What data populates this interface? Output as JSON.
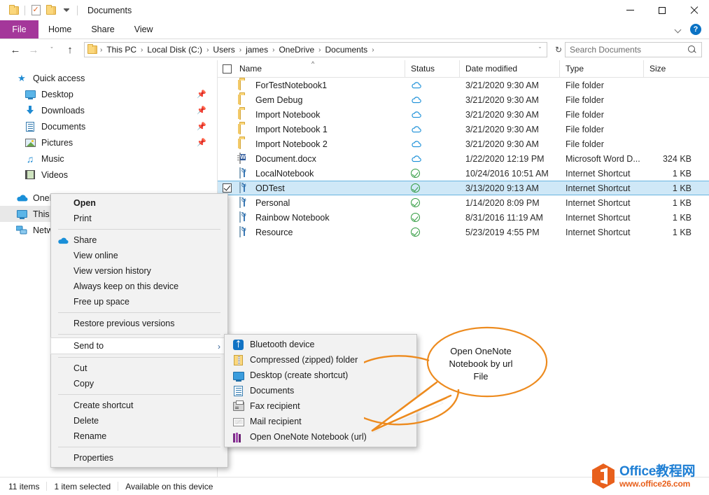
{
  "window": {
    "title": "Documents",
    "quick_access_icons": [
      "folder-icon",
      "properties-icon",
      "new-folder-icon",
      "customize-qat-caret"
    ],
    "controls": {
      "minimize": "—",
      "maximize": "□",
      "close": "✕"
    }
  },
  "ribbon": {
    "tabs": [
      {
        "label": "File",
        "active_color": "#a4379a"
      },
      {
        "label": "Home"
      },
      {
        "label": "Share"
      },
      {
        "label": "View"
      }
    ],
    "collapse_icon": "chevron-down-icon",
    "help_label": "?"
  },
  "address_bar": {
    "back_glyph": "←",
    "forward_glyph": "→",
    "recent_glyph": "ˇ",
    "up_glyph": "↑",
    "breadcrumbs": [
      "This PC",
      "Local Disk (C:)",
      "Users",
      "james",
      "OneDrive",
      "Documents"
    ],
    "separator": "›",
    "dropdown_glyph": "ˇ",
    "refresh_glyph": "↻"
  },
  "search": {
    "placeholder": "Search Documents",
    "value": "",
    "icon": "search-icon"
  },
  "sidebar": {
    "items": [
      {
        "label": "Quick access",
        "icon": "star-pin-icon",
        "level": 0,
        "pinned": false
      },
      {
        "label": "Desktop",
        "icon": "desktop-icon",
        "level": 1,
        "pinned": true
      },
      {
        "label": "Downloads",
        "icon": "downloads-icon",
        "level": 1,
        "pinned": true
      },
      {
        "label": "Documents",
        "icon": "documents-icon",
        "level": 1,
        "pinned": true
      },
      {
        "label": "Pictures",
        "icon": "pictures-icon",
        "level": 1,
        "pinned": true
      },
      {
        "label": "Music",
        "icon": "music-icon",
        "level": 1,
        "pinned": false
      },
      {
        "label": "Videos",
        "icon": "videos-icon",
        "level": 1,
        "pinned": false
      },
      {
        "label": "OneDrive",
        "icon": "onedrive-cloud-icon",
        "level": 0,
        "pinned": false
      },
      {
        "label": "This PC",
        "icon": "this-pc-icon",
        "level": 0,
        "pinned": false,
        "selected": true
      },
      {
        "label": "Network",
        "icon": "network-icon",
        "level": 0,
        "pinned": false
      }
    ]
  },
  "file_list": {
    "columns": [
      "Name",
      "Status",
      "Date modified",
      "Type",
      "Size"
    ],
    "sort_column": "Name",
    "sort_direction": "ascending",
    "rows": [
      {
        "name": "ForTestNotebook1",
        "icon": "folder-icon",
        "status": "cloud-only-icon",
        "date": "3/21/2020 9:30 AM",
        "type": "File folder",
        "size": ""
      },
      {
        "name": "Gem Debug",
        "icon": "folder-icon",
        "status": "cloud-only-icon",
        "date": "3/21/2020 9:30 AM",
        "type": "File folder",
        "size": ""
      },
      {
        "name": "Import Notebook",
        "icon": "folder-icon",
        "status": "cloud-only-icon",
        "date": "3/21/2020 9:30 AM",
        "type": "File folder",
        "size": ""
      },
      {
        "name": "Import Notebook 1",
        "icon": "folder-icon",
        "status": "cloud-only-icon",
        "date": "3/21/2020 9:30 AM",
        "type": "File folder",
        "size": ""
      },
      {
        "name": "Import Notebook 2",
        "icon": "folder-icon",
        "status": "cloud-only-icon",
        "date": "3/21/2020 9:30 AM",
        "type": "File folder",
        "size": ""
      },
      {
        "name": "Document.docx",
        "icon": "word-document-icon",
        "status": "cloud-only-icon",
        "date": "1/22/2020 12:19 PM",
        "type": "Microsoft Word D...",
        "size": "324 KB"
      },
      {
        "name": "LocalNotebook",
        "icon": "internet-shortcut-icon",
        "status": "available-on-device-icon",
        "date": "10/24/2016 10:51 AM",
        "type": "Internet Shortcut",
        "size": "1 KB"
      },
      {
        "name": "ODTest",
        "icon": "internet-shortcut-icon",
        "status": "available-on-device-icon",
        "date": "3/13/2020 9:13 AM",
        "type": "Internet Shortcut",
        "size": "1 KB",
        "selected": true
      },
      {
        "name": "Personal",
        "icon": "internet-shortcut-icon",
        "status": "available-on-device-icon",
        "date": "1/14/2020 8:09 PM",
        "type": "Internet Shortcut",
        "size": "1 KB"
      },
      {
        "name": "Rainbow Notebook",
        "icon": "internet-shortcut-icon",
        "status": "available-on-device-icon",
        "date": "8/31/2016 11:19 AM",
        "type": "Internet Shortcut",
        "size": "1 KB"
      },
      {
        "name": "Resource",
        "icon": "internet-shortcut-icon",
        "status": "available-on-device-icon",
        "date": "5/23/2019 4:55 PM",
        "type": "Internet Shortcut",
        "size": "1 KB"
      }
    ]
  },
  "context_menu": {
    "items": [
      {
        "label": "Open",
        "bold": true
      },
      {
        "label": "Print"
      },
      {
        "separator": true
      },
      {
        "label": "Share",
        "icon": "onedrive-cloud-icon"
      },
      {
        "label": "View online"
      },
      {
        "label": "View version history"
      },
      {
        "label": "Always keep on this device"
      },
      {
        "label": "Free up space"
      },
      {
        "separator": true
      },
      {
        "label": "Restore previous versions"
      },
      {
        "separator": true
      },
      {
        "label": "Send to",
        "submenu": true,
        "highlighted": true,
        "arrow": "›"
      },
      {
        "separator": true
      },
      {
        "label": "Cut"
      },
      {
        "label": "Copy"
      },
      {
        "separator": true
      },
      {
        "label": "Create shortcut"
      },
      {
        "label": "Delete"
      },
      {
        "label": "Rename"
      },
      {
        "separator": true
      },
      {
        "label": "Properties"
      }
    ]
  },
  "send_to_submenu": {
    "items": [
      {
        "label": "Bluetooth device",
        "icon": "bluetooth-icon"
      },
      {
        "label": "Compressed (zipped) folder",
        "icon": "zip-folder-icon"
      },
      {
        "label": "Desktop (create shortcut)",
        "icon": "desktop-icon"
      },
      {
        "label": "Documents",
        "icon": "documents-icon"
      },
      {
        "label": "Fax recipient",
        "icon": "fax-icon"
      },
      {
        "label": "Mail recipient",
        "icon": "mail-icon"
      },
      {
        "label": "Open OneNote Notebook (url)",
        "icon": "onenote-icon"
      }
    ]
  },
  "callout": {
    "text_lines": [
      "Open OneNote",
      "Notebook by url",
      "File"
    ],
    "border_color": "#ed8b1f"
  },
  "status_bar": {
    "items": [
      "11 items",
      "1 item selected",
      "Available on this device"
    ]
  },
  "watermark": {
    "line1": "Office教程网",
    "line2": "www.office26.com",
    "logo_color": "#e8601c",
    "text_color": "#1f7fd4"
  }
}
